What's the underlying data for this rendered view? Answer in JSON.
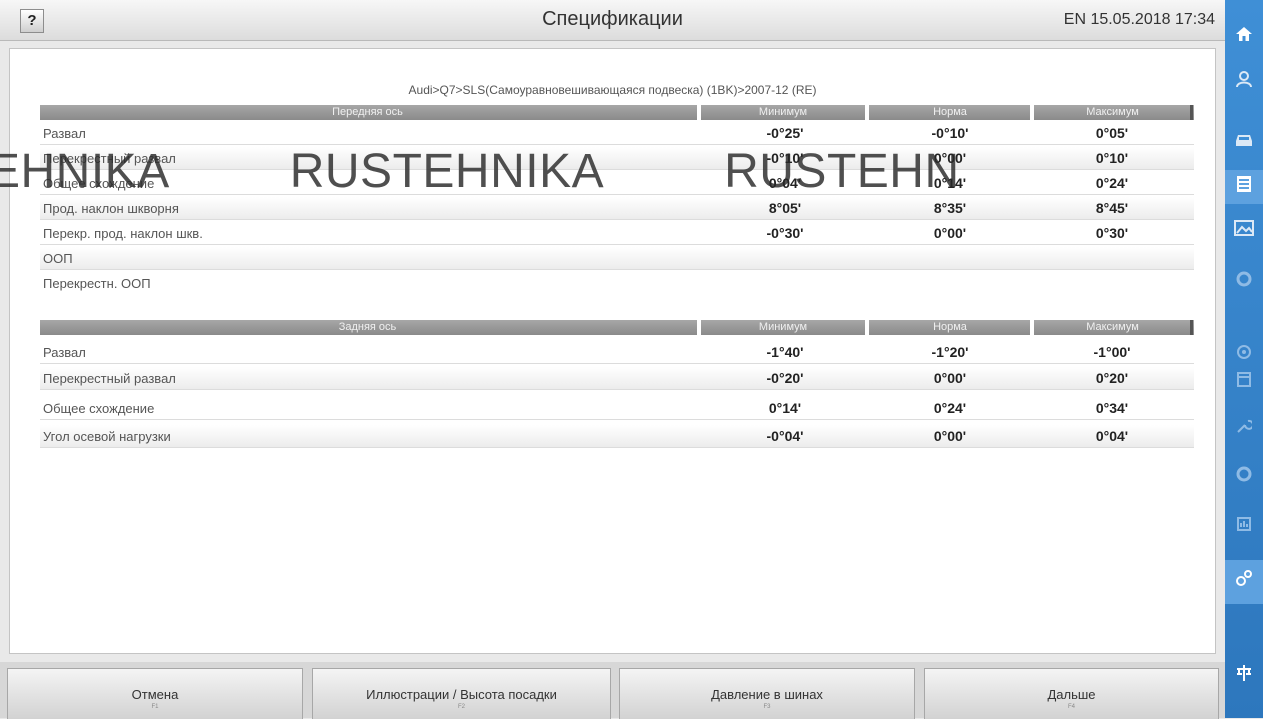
{
  "header": {
    "help_label": "?",
    "title": "Спецификации",
    "status": "EN 15.05.2018 17:34"
  },
  "sidebar": {
    "icons": [
      "home-icon",
      "person-icon",
      "car-icon",
      "document-icon",
      "picture-icon",
      "gauge-icon",
      "steering-icon",
      "calendar-icon",
      "wrench-icon",
      "settings-wheel-icon",
      "report-icon",
      "gears-icon",
      "network-icon"
    ],
    "active": "gears-icon"
  },
  "breadcrumb": "Audi>Q7>SLS(Самоуравновешивающаяся подвеска) (1BK)>2007-12 (RE)",
  "front": {
    "header": {
      "axis": "Передняя ось",
      "min": "Минимум",
      "nom": "Норма",
      "max": "Максимум"
    },
    "rows": [
      {
        "label": "Развал",
        "min": "-0°25'",
        "nom": "-0°10'",
        "max": "0°05'"
      },
      {
        "label": "Перекрестный развал",
        "min": "-0°10'",
        "nom": "0°00'",
        "max": "0°10'"
      },
      {
        "label": "Общее схождение",
        "min": "0°04'",
        "nom": "0°14'",
        "max": "0°24'"
      },
      {
        "label": "Прод. наклон шкворня",
        "min": "8°05'",
        "nom": "8°35'",
        "max": "8°45'"
      },
      {
        "label": "Перекр. прод. наклон шкв.",
        "min": "-0°30'",
        "nom": "0°00'",
        "max": "0°30'"
      },
      {
        "label": "ООП",
        "min": "",
        "nom": "",
        "max": ""
      },
      {
        "label": "Перекрестн. ООП",
        "min": "",
        "nom": "",
        "max": ""
      }
    ]
  },
  "rear": {
    "header": {
      "axis": "Задняя ось",
      "min": "Минимум",
      "nom": "Норма",
      "max": "Максимум"
    },
    "rows": [
      {
        "label": "Развал",
        "min": "-1°40'",
        "nom": "-1°20'",
        "max": "-1°00'"
      },
      {
        "label": "Перекрестный развал",
        "min": "-0°20'",
        "nom": "0°00'",
        "max": "0°20'"
      },
      {
        "label": "Общее схождение",
        "min": "0°14'",
        "nom": "0°24'",
        "max": "0°34'"
      },
      {
        "label": "Угол осевой нагрузки",
        "min": "-0°04'",
        "nom": "0°00'",
        "max": "0°04'"
      }
    ]
  },
  "watermark": [
    "EHNIKA",
    "RUSTEHNIKA",
    "RUSTEHN"
  ],
  "footer": {
    "buttons": [
      {
        "label": "Отмена",
        "key": "F1"
      },
      {
        "label": "Иллюстрации / Высота посадки",
        "key": "F2"
      },
      {
        "label": "Давление в шинах",
        "key": "F3"
      },
      {
        "label": "Дальше",
        "key": "F4"
      }
    ]
  }
}
